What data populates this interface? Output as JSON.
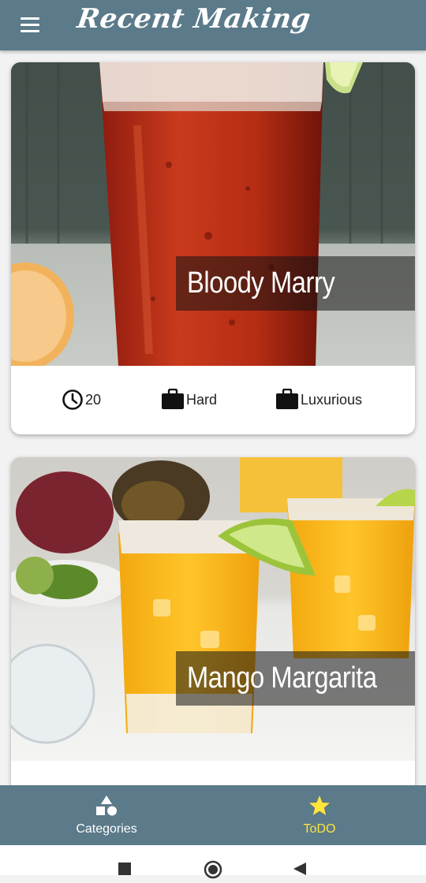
{
  "app": {
    "title": "Recent Making"
  },
  "icons": {
    "menu": "hamburger-menu-icon",
    "clock": "clock-icon",
    "briefcase": "briefcase-icon",
    "categories": "shapes-icon",
    "todo": "star-icon"
  },
  "colors": {
    "appbar": "#5b7a8a",
    "active_tab": "#ffe43a",
    "inactive_tab": "#ffffff"
  },
  "recipes": [
    {
      "title": "Bloody Marry",
      "duration": "20",
      "complexity": "Hard",
      "affordability": "Luxurious"
    },
    {
      "title": "Mango Margarita"
    }
  ],
  "bottom_nav": {
    "categories_label": "Categories",
    "todo_label": "ToDO",
    "active": "ToDO"
  },
  "system_nav": [
    "recents-button",
    "home-button",
    "back-button"
  ]
}
